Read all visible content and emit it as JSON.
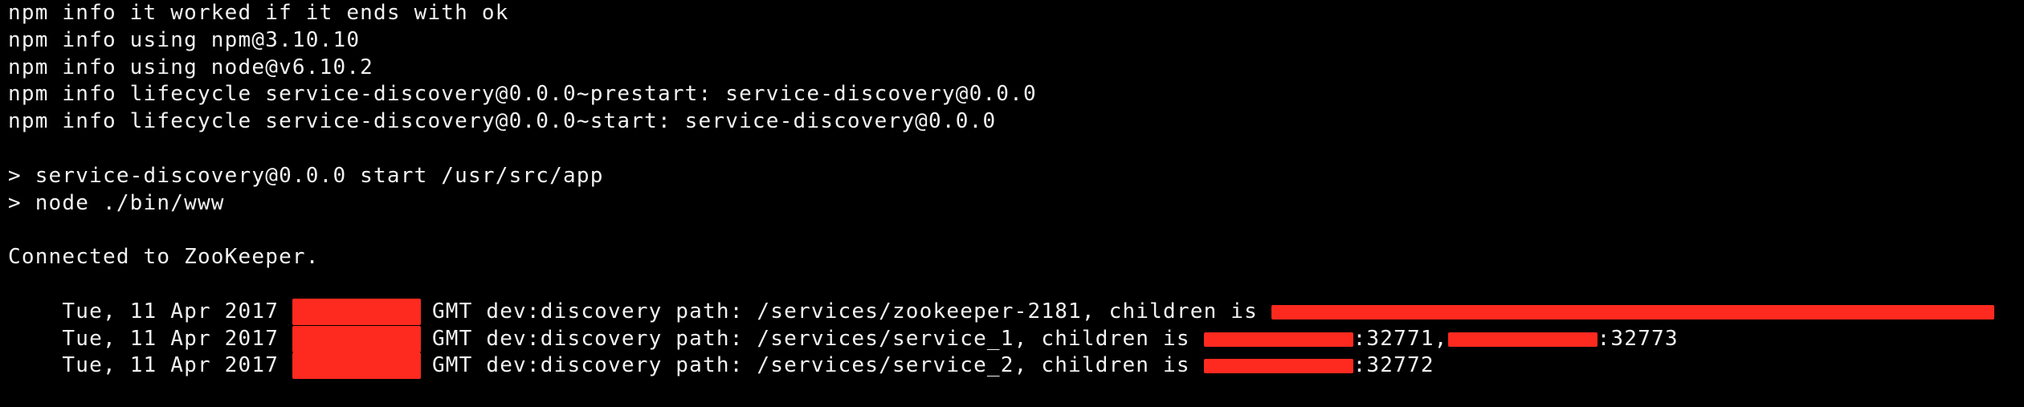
{
  "terminal": {
    "lines": [
      "npm info it worked if it ends with ok",
      "npm info using npm@3.10.10",
      "npm info using node@v6.10.2",
      "npm info lifecycle service-discovery@0.0.0~prestart: service-discovery@0.0.0",
      "npm info lifecycle service-discovery@0.0.0~start: service-discovery@0.0.0",
      "",
      "> service-discovery@0.0.0 start /usr/src/app",
      "> node ./bin/www",
      "",
      "Connected to ZooKeeper."
    ],
    "log_lines": [
      {
        "prefix": "Tue, 11 Apr 2017 ",
        "text": "GMT dev:discovery path: /services/zookeeper-2181, children is ",
        "ports": []
      },
      {
        "prefix": "Tue, 11 Apr 2017 ",
        "text": "GMT dev:discovery path: /services/service_1, children is ",
        "ports": [
          ":32771,",
          ":32773"
        ]
      },
      {
        "prefix": "Tue, 11 Apr 2017 ",
        "text": "GMT dev:discovery path: /services/service_2, children is ",
        "ports": [
          ":32772"
        ]
      }
    ]
  },
  "colors": {
    "background": "#000000",
    "foreground": "#f2f2f2",
    "redaction": "#ff2a1f"
  }
}
